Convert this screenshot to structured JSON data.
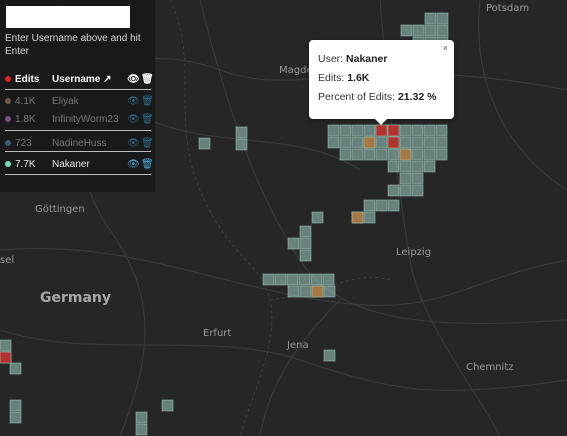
{
  "map": {
    "cities": [
      {
        "name": "Potsdam",
        "key": "potsdam"
      },
      {
        "name": "Magde",
        "key": "magdeburg"
      },
      {
        "name": "Göttingen",
        "key": "goettingen"
      },
      {
        "name": "Leipzig",
        "key": "leipzig"
      },
      {
        "name": "Germany",
        "key": "germany"
      },
      {
        "name": "Erfurt",
        "key": "erfurt"
      },
      {
        "name": "Jena",
        "key": "jena"
      },
      {
        "name": "Chemnitz",
        "key": "chemnitz"
      },
      {
        "name": "sel",
        "key": "kassel"
      }
    ],
    "heat_colors": {
      "low": "#9fd0c4",
      "mid": "#b4773a",
      "high": "#c0241f"
    }
  },
  "panel": {
    "username_input": {
      "value": "",
      "placeholder": ""
    },
    "hint": "Enter Username above and hit Enter",
    "header": {
      "edits": "Edits",
      "username": "Username",
      "sort_icon": "arrow-up-right-icon",
      "eye_icon": "eye-icon",
      "trash_icon": "trash-icon"
    },
    "users": [
      {
        "edits": "4.1K",
        "name": "Eliyak",
        "color": "#6b5a4a",
        "visible": false
      },
      {
        "edits": "1.8K",
        "name": "InfinityWorm23",
        "color": "#7c4f8a",
        "visible": false
      },
      {
        "edits": "723",
        "name": "NadineHuss",
        "color": "#3a5a7a",
        "visible": false
      },
      {
        "edits": "7.7K",
        "name": "Nakaner",
        "color": "#6fe0c8",
        "visible": true
      }
    ],
    "header_dot_color": "#e02424"
  },
  "popup": {
    "user_label": "User:",
    "user_value": "Nakaner",
    "edits_label": "Edits:",
    "edits_value": "1.6K",
    "percent_label": "Percent of Edits:",
    "percent_value": "21.32 %",
    "close": "×"
  }
}
